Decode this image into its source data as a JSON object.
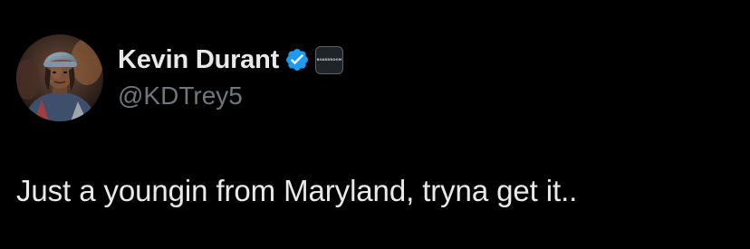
{
  "author": {
    "display_name": "Kevin Durant",
    "handle": "@KDTrey5",
    "avatar_icon": "avatar-photo",
    "verified_icon": "verified-badge-icon",
    "verified_color": "#1d9bf0",
    "affiliate_badge_text": "BOARDROOM"
  },
  "tweet": {
    "text": "Just a youngin from Maryland, tryna get it.."
  },
  "colors": {
    "background": "#000000",
    "primary_text": "#e7e9ea",
    "secondary_text": "#71767b"
  }
}
